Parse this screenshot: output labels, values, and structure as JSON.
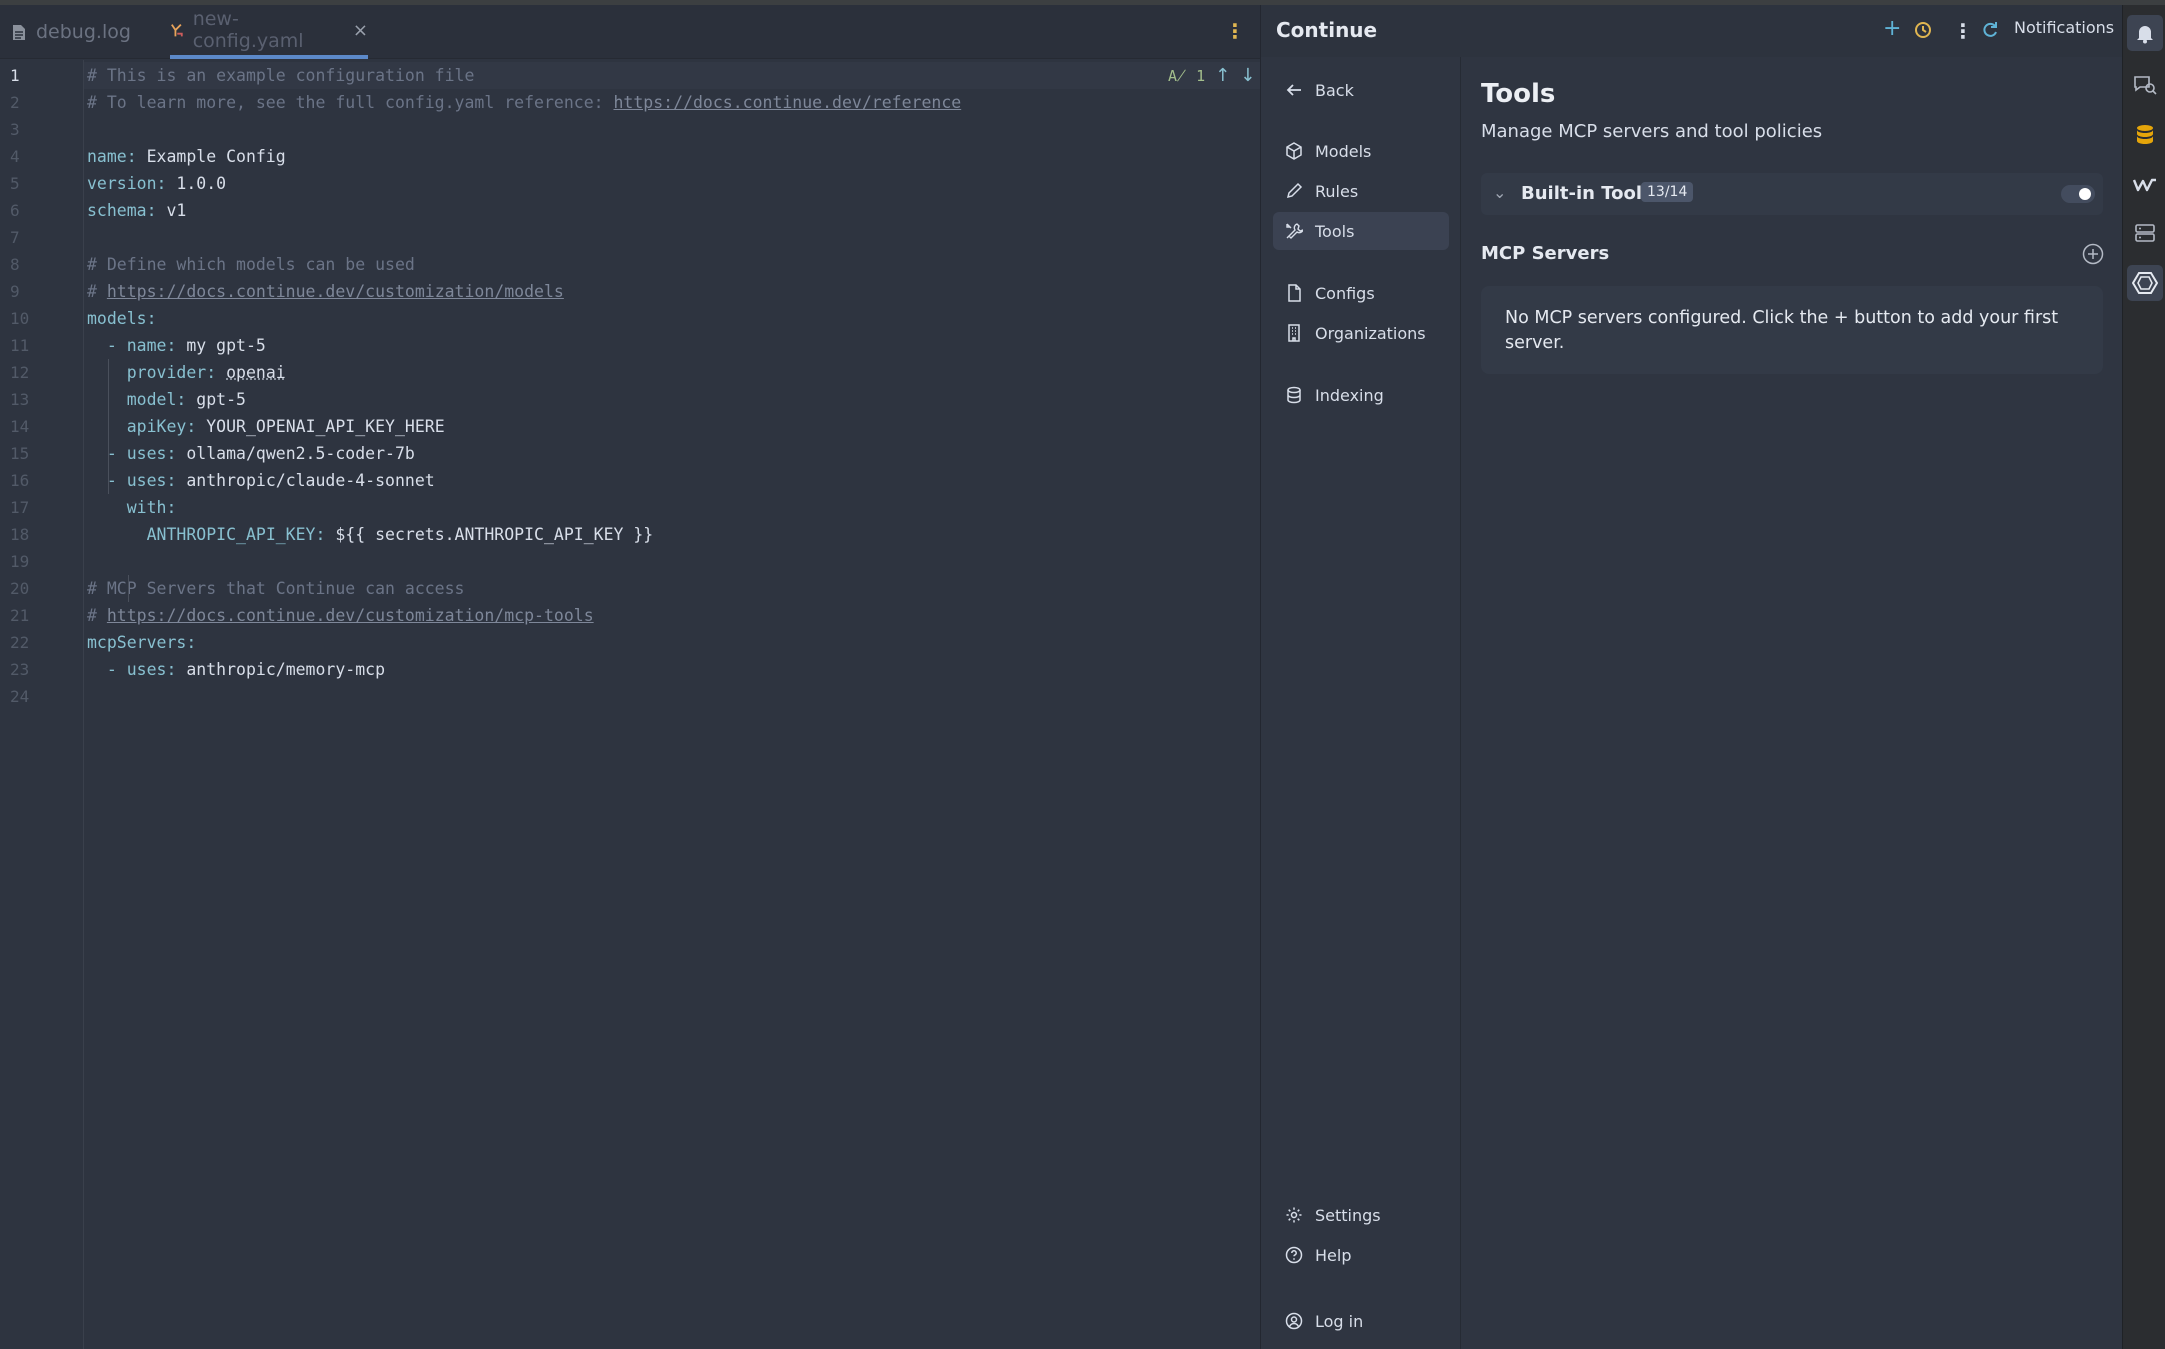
{
  "editor": {
    "tabs": [
      {
        "label": "debug.log",
        "icon": "file-text-icon"
      },
      {
        "label": "new-config.yaml",
        "icon": "yaml-file-icon",
        "close": "×"
      }
    ],
    "inspection": {
      "count": "1"
    },
    "line_numbers": [
      "1",
      "2",
      "3",
      "4",
      "5",
      "6",
      "7",
      "8",
      "9",
      "10",
      "11",
      "12",
      "13",
      "14",
      "15",
      "16",
      "17",
      "18",
      "19",
      "20",
      "21",
      "22",
      "23",
      "24"
    ],
    "lines": {
      "l1": "# This is an example configuration file",
      "l2_prefix": "# To learn more, see the full config.yaml reference: ",
      "l2_link": "https://docs.continue.dev/reference",
      "l4_key": "name:",
      "l4_val": " Example Config",
      "l5_key": "version:",
      "l5_val": " 1.0.0",
      "l6_key": "schema:",
      "l6_val": " v1",
      "l8": "# Define which models can be used",
      "l9_prefix": "# ",
      "l9_link": "https://docs.continue.dev/customization/models",
      "l10_key": "models:",
      "l11_dash": "  - ",
      "l11_key": "name:",
      "l11_val": " my gpt-5",
      "l12_key": "provider:",
      "l12_val": "openai",
      "l13_key": "model:",
      "l13_val": " gpt-5",
      "l14_key": "apiKey:",
      "l14_val": " YOUR_OPENAI_API_KEY_HERE",
      "l15_dash": "  - ",
      "l15_key": "uses:",
      "l15_val": " ollama/qwen2.5-coder-7b",
      "l16_dash": "  - ",
      "l16_key": "uses:",
      "l16_val": " anthropic/claude-4-sonnet",
      "l17_key": "with:",
      "l18_key": "ANTHROPIC_API_KEY:",
      "l18_val": " ${{ secrets.ANTHROPIC_API_KEY }}",
      "l20": "# MCP Servers that Continue can access",
      "l21_prefix": "# ",
      "l21_link": "https://docs.continue.dev/customization/mcp-tools",
      "l22_key": "mcpServers:",
      "l23_dash": "  - ",
      "l23_key": "uses:",
      "l23_val": " anthropic/memory-mcp"
    }
  },
  "panel": {
    "title": "Continue",
    "notifications_label": "Notifications",
    "nav": {
      "back": "Back",
      "models": "Models",
      "rules": "Rules",
      "tools": "Tools",
      "configs": "Configs",
      "organizations": "Organizations",
      "indexing": "Indexing",
      "settings": "Settings",
      "help": "Help",
      "login": "Log in"
    },
    "content": {
      "title": "Tools",
      "subtitle": "Manage MCP servers and tool policies",
      "builtin_label": "Built-in Tools",
      "builtin_badge": "13/14",
      "builtin_enabled": true,
      "mcp_heading": "MCP Servers",
      "mcp_empty": "No MCP servers configured. Click the + button to add your first server."
    }
  },
  "colors": {
    "accent": "#88c0d0",
    "active_tab_underline": "#5c89c9",
    "warning_menu": "#e0b651",
    "database_icon": "#e5a50a"
  }
}
